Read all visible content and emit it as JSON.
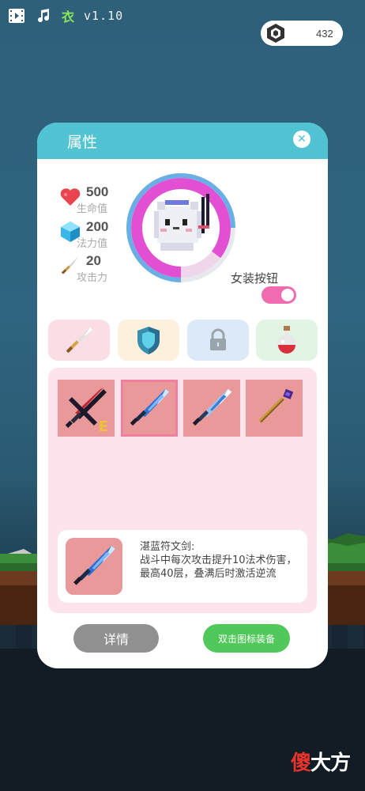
{
  "status_bar": {
    "video_icon": "film-icon",
    "music_icon": "music-note-icon",
    "outfit_label": "衣",
    "version": "v1.10"
  },
  "currency": {
    "icon": "gem-icon",
    "value": "432"
  },
  "dialog": {
    "title": "属性",
    "close_icon": "close-icon",
    "stats": [
      {
        "icon": "heart-icon",
        "value": "500",
        "label": "生命值"
      },
      {
        "icon": "crystal-icon",
        "value": "200",
        "label": "法力值"
      },
      {
        "icon": "sword-icon",
        "value": "20",
        "label": "攻击力"
      }
    ],
    "toggle": {
      "label": "女装按钮",
      "on": true,
      "color": "#f06bb0"
    },
    "tabs": [
      {
        "name": "weapons",
        "icon": "sword-icon"
      },
      {
        "name": "armor",
        "icon": "shield-icon"
      },
      {
        "name": "locked",
        "icon": "lock-icon"
      },
      {
        "name": "potions",
        "icon": "potion-icon"
      }
    ],
    "inventory": {
      "slots": [
        {
          "icon": "dark-cross-sword-icon",
          "equipped_mark": "E"
        },
        {
          "icon": "rune-blue-sword-icon",
          "selected": true
        },
        {
          "icon": "ice-sword-icon"
        },
        {
          "icon": "purple-staff-icon"
        }
      ],
      "detail": {
        "icon": "rune-blue-sword-icon",
        "text": "湛蓝符文剑:\n战斗中每次攻击提升10法术伤害，最高40层，叠满后时激活逆流"
      }
    },
    "buttons": {
      "detail": "详情",
      "equip": "双击图标装备"
    }
  },
  "watermark": {
    "part1": "傻",
    "part2": "大方"
  },
  "colors": {
    "header": "#52c3d3",
    "equip_button": "#51c95a",
    "detail_button": "#909090"
  }
}
